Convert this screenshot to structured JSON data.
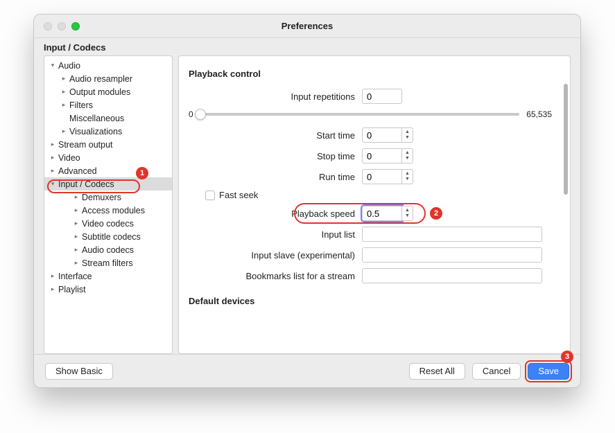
{
  "window": {
    "title": "Preferences"
  },
  "section": "Input / Codecs",
  "tree": {
    "items": [
      {
        "label": "Audio",
        "indent": 0,
        "arrow": "▾"
      },
      {
        "label": "Audio resampler",
        "indent": 1,
        "arrow": "▸"
      },
      {
        "label": "Output modules",
        "indent": 1,
        "arrow": "▸"
      },
      {
        "label": "Filters",
        "indent": 1,
        "arrow": "▸"
      },
      {
        "label": "Miscellaneous",
        "indent": 1,
        "arrow": ""
      },
      {
        "label": "Visualizations",
        "indent": 1,
        "arrow": "▸"
      },
      {
        "label": "Stream output",
        "indent": 0,
        "arrow": "▸"
      },
      {
        "label": "Video",
        "indent": 0,
        "arrow": "▸"
      },
      {
        "label": "Advanced",
        "indent": 0,
        "arrow": "▸"
      },
      {
        "label": "Input / Codecs",
        "indent": 0,
        "arrow": "▾",
        "selected": true
      },
      {
        "label": "Demuxers",
        "indent": 2,
        "arrow": "▸"
      },
      {
        "label": "Access modules",
        "indent": 2,
        "arrow": "▸"
      },
      {
        "label": "Video codecs",
        "indent": 2,
        "arrow": "▸"
      },
      {
        "label": "Subtitle codecs",
        "indent": 2,
        "arrow": "▸"
      },
      {
        "label": "Audio codecs",
        "indent": 2,
        "arrow": "▸"
      },
      {
        "label": "Stream filters",
        "indent": 2,
        "arrow": "▸"
      },
      {
        "label": "Interface",
        "indent": 0,
        "arrow": "▸"
      },
      {
        "label": "Playlist",
        "indent": 0,
        "arrow": "▸"
      }
    ]
  },
  "panel": {
    "group1": "Playback control",
    "input_repetitions": {
      "label": "Input repetitions",
      "value": "0"
    },
    "slider": {
      "min": "0",
      "max": "65,535"
    },
    "start_time": {
      "label": "Start time",
      "value": "0"
    },
    "stop_time": {
      "label": "Stop time",
      "value": "0"
    },
    "run_time": {
      "label": "Run time",
      "value": "0"
    },
    "fast_seek": {
      "label": "Fast seek"
    },
    "playback_speed": {
      "label": "Playback speed",
      "value": "0.5"
    },
    "input_list": {
      "label": "Input list",
      "value": ""
    },
    "input_slave": {
      "label": "Input slave (experimental)",
      "value": ""
    },
    "bookmarks": {
      "label": "Bookmarks list for a stream",
      "value": ""
    },
    "group2": "Default devices"
  },
  "buttons": {
    "show_basic": "Show Basic",
    "reset_all": "Reset All",
    "cancel": "Cancel",
    "save": "Save"
  },
  "annotations": {
    "n1": "1",
    "n2": "2",
    "n3": "3"
  }
}
